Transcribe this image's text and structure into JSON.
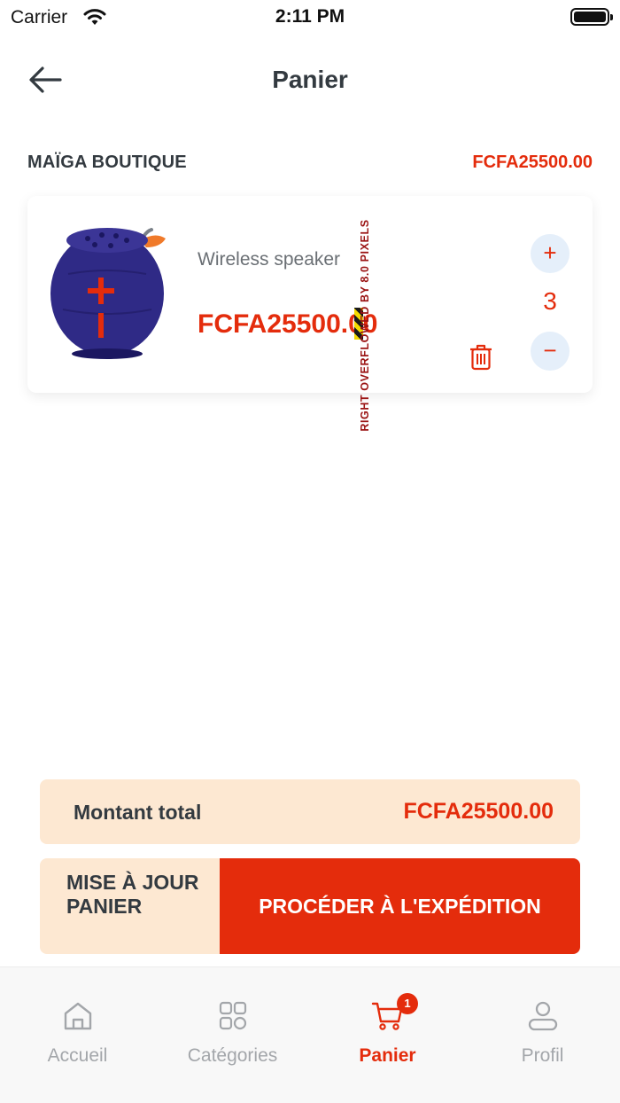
{
  "status_bar": {
    "carrier": "Carrier",
    "time": "2:11 PM"
  },
  "header": {
    "title": "Panier",
    "back_icon": "arrow-left-icon"
  },
  "shop": {
    "name": "MAÏGA BOUTIQUE",
    "total": "FCFA25500.00"
  },
  "cart_item": {
    "name": "Wireless speaker",
    "price": "FCFA25500.00",
    "quantity": "3",
    "plus_label": "+",
    "minus_label": "−",
    "overflow_warning": "RIGHT OVERFLOWED BY 8.0 PIXELS"
  },
  "summary": {
    "label": "Montant total",
    "value": "FCFA25500.00"
  },
  "actions": {
    "update_label": "MISE À JOUR PANIER",
    "checkout_label": "PROCÉDER À L'EXPÉDITION"
  },
  "bottom_nav": {
    "items": [
      {
        "label": "Accueil",
        "icon": "home-icon"
      },
      {
        "label": "Catégories",
        "icon": "grid-icon"
      },
      {
        "label": "Panier",
        "icon": "cart-icon",
        "active": true
      },
      {
        "label": "Profil",
        "icon": "user-icon"
      }
    ],
    "cart_badge": "1"
  },
  "colors": {
    "accent": "#e42c0c",
    "panel": "#fde8d2",
    "text": "#333a40",
    "muted": "#a3a6aa"
  }
}
